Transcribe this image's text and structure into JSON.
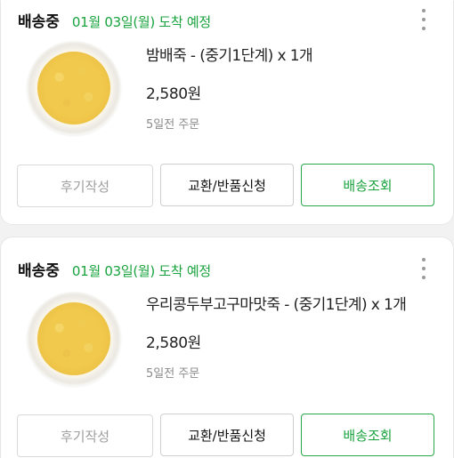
{
  "orders": [
    {
      "status": "배송중",
      "eta": "01월 03일(월) 도착 예정",
      "product": "밤배죽 - (중기1단계) x 1개",
      "price": "2,580원",
      "ordered": "5일전 주문",
      "buttons": {
        "review": "후기작성",
        "exchange": "교환/반품신청",
        "track": "배송조회"
      }
    },
    {
      "status": "배송중",
      "eta": "01월 03일(월) 도착 예정",
      "product": "우리콩두부고구마맛죽 - (중기1단계) x 1개",
      "price": "2,580원",
      "ordered": "5일전 주문",
      "buttons": {
        "review": "후기작성",
        "exchange": "교환/반품신청",
        "track": "배송조회"
      }
    }
  ],
  "icons": {
    "more": "more-vertical-icon"
  },
  "colors": {
    "accent": "#19a33e",
    "muted": "#9e9e9e"
  }
}
